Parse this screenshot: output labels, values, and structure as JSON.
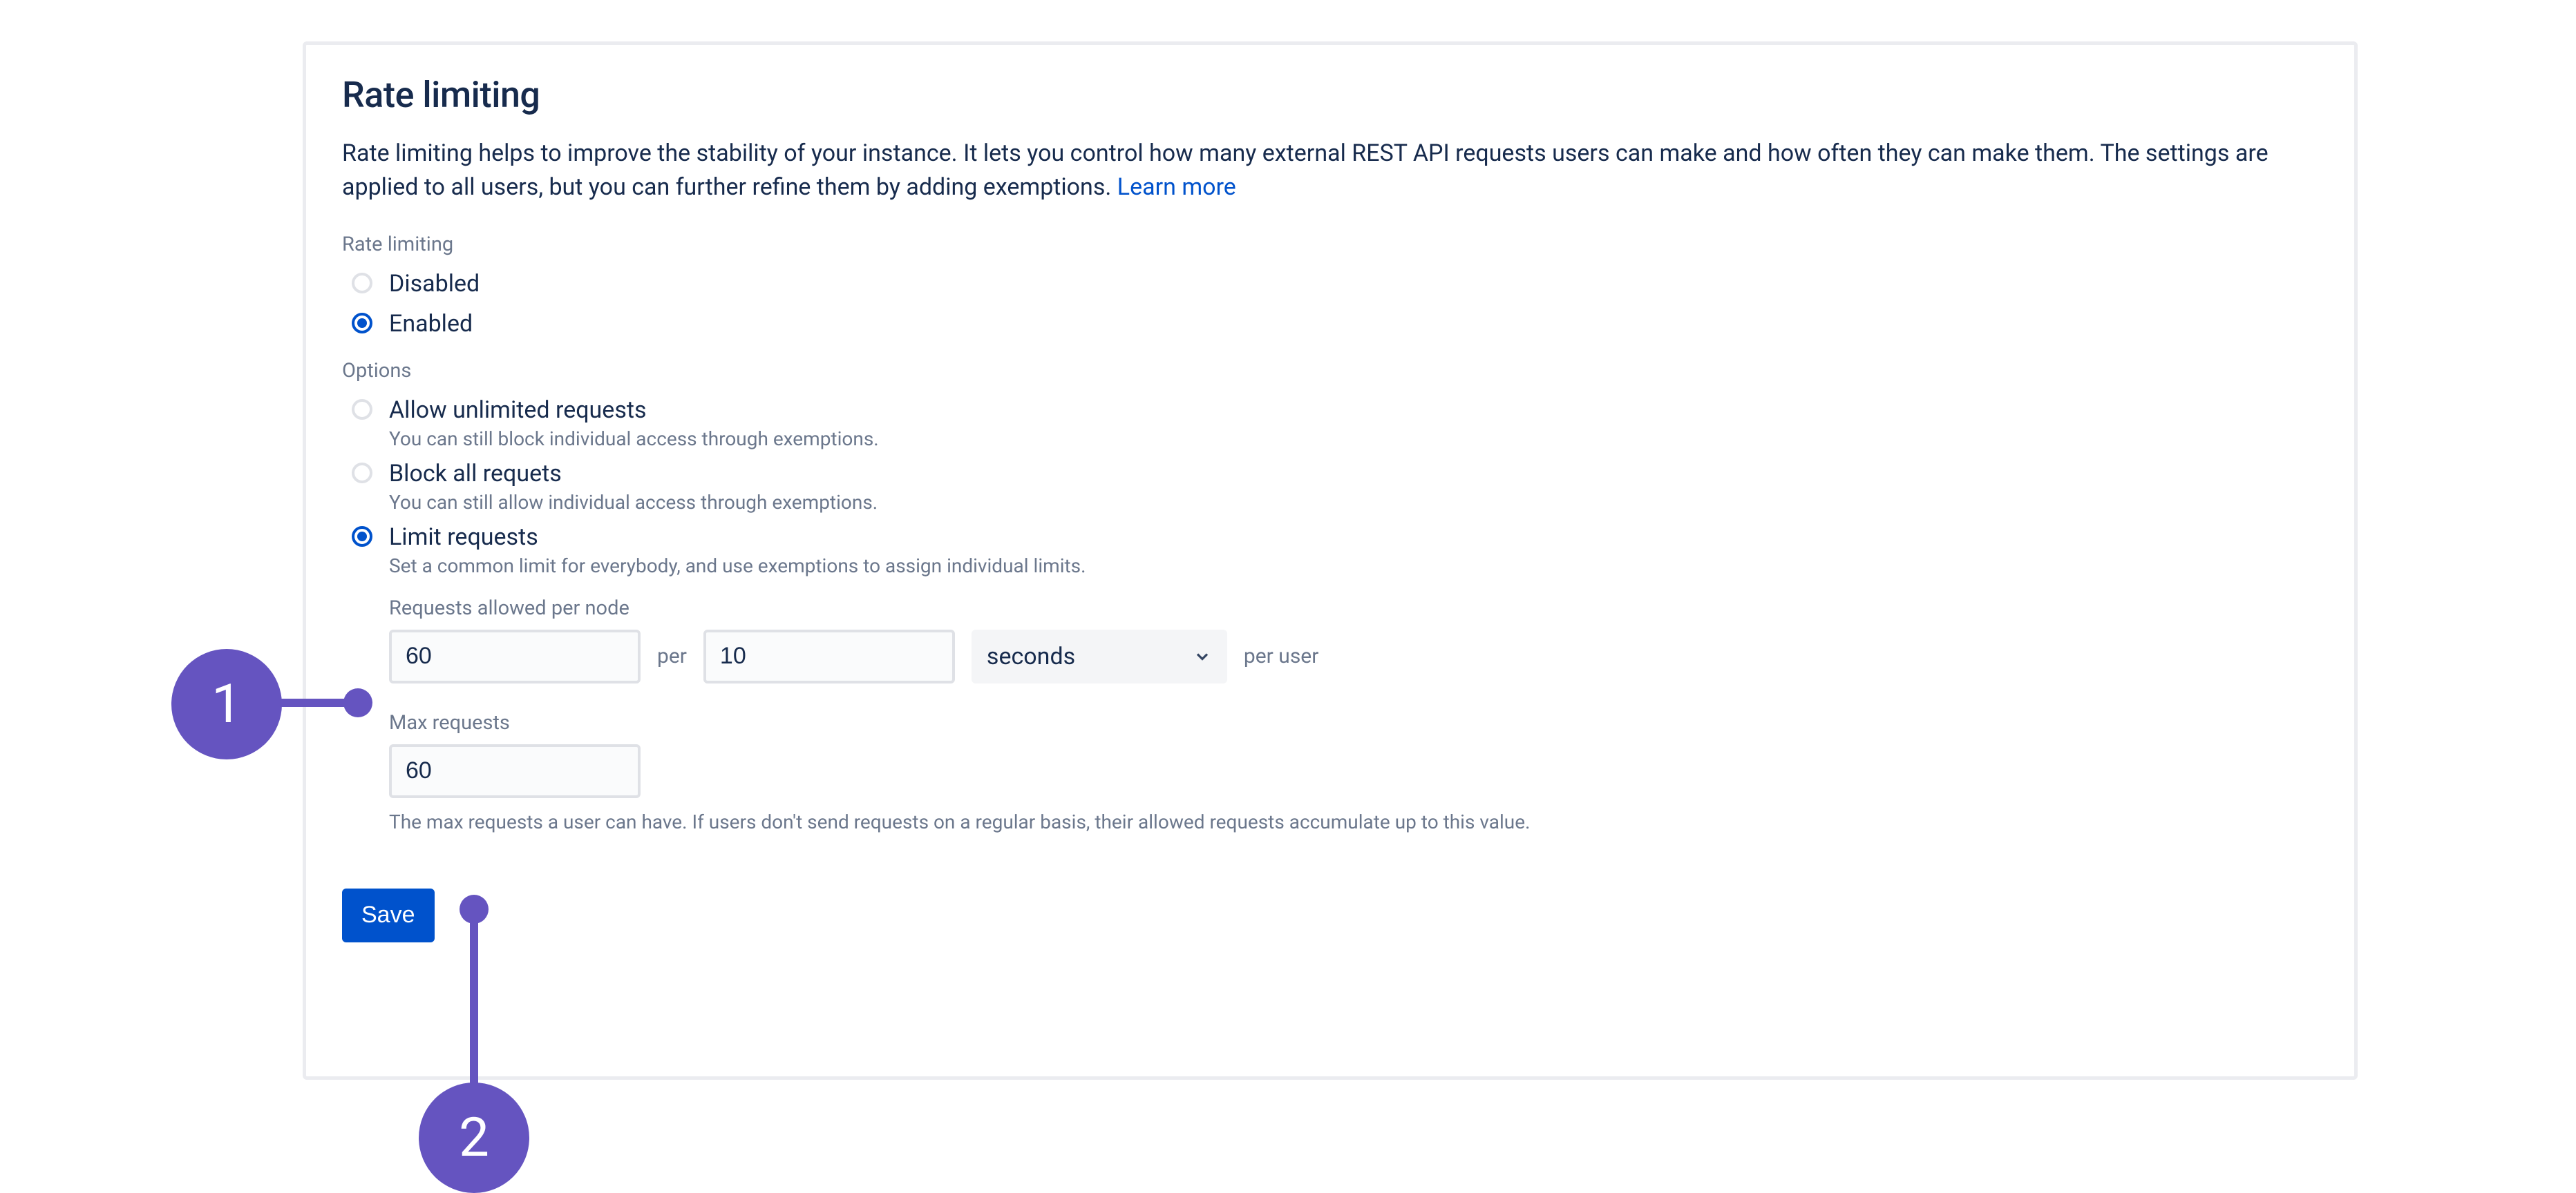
{
  "page": {
    "title": "Rate limiting",
    "description": "Rate limiting helps to improve the stability of your instance. It lets you control how many external REST API requests users can make and how often they can make them. The settings are applied to all users, but you can further refine them by adding exemptions.",
    "learn_more": "Learn more"
  },
  "state_section": {
    "label": "Rate limiting",
    "options": {
      "disabled": "Disabled",
      "enabled": "Enabled"
    },
    "selected": "enabled"
  },
  "options_section": {
    "label": "Options",
    "items": {
      "allow_unlimited": {
        "label": "Allow unlimited requests",
        "help": "You can still block individual access through exemptions."
      },
      "block_all": {
        "label": "Block all requets",
        "help": "You can still allow individual access through exemptions."
      },
      "limit": {
        "label": "Limit requests",
        "help": "Set a common limit for everybody, and use exemptions to assign individual limits."
      }
    },
    "selected": "limit"
  },
  "limit_fields": {
    "requests_allowed": {
      "label": "Requests allowed per node",
      "count_value": "60",
      "per_text": "per",
      "interval_value": "10",
      "unit_value": "seconds",
      "after_text": "per user"
    },
    "max_requests": {
      "label": "Max requests",
      "value": "60",
      "help": "The max requests a user can have. If users don't send requests on a regular basis, their allowed requests accumulate up to this value."
    }
  },
  "actions": {
    "save": "Save"
  },
  "annotations": {
    "one": "1",
    "two": "2"
  },
  "colors": {
    "accent": "#0052CC",
    "annotation": "#6554C0",
    "text": "#172B4D",
    "muted": "#6B778C",
    "border": "#DFE1E6",
    "field_bg": "#FAFBFC",
    "select_bg": "#F4F5F7"
  }
}
